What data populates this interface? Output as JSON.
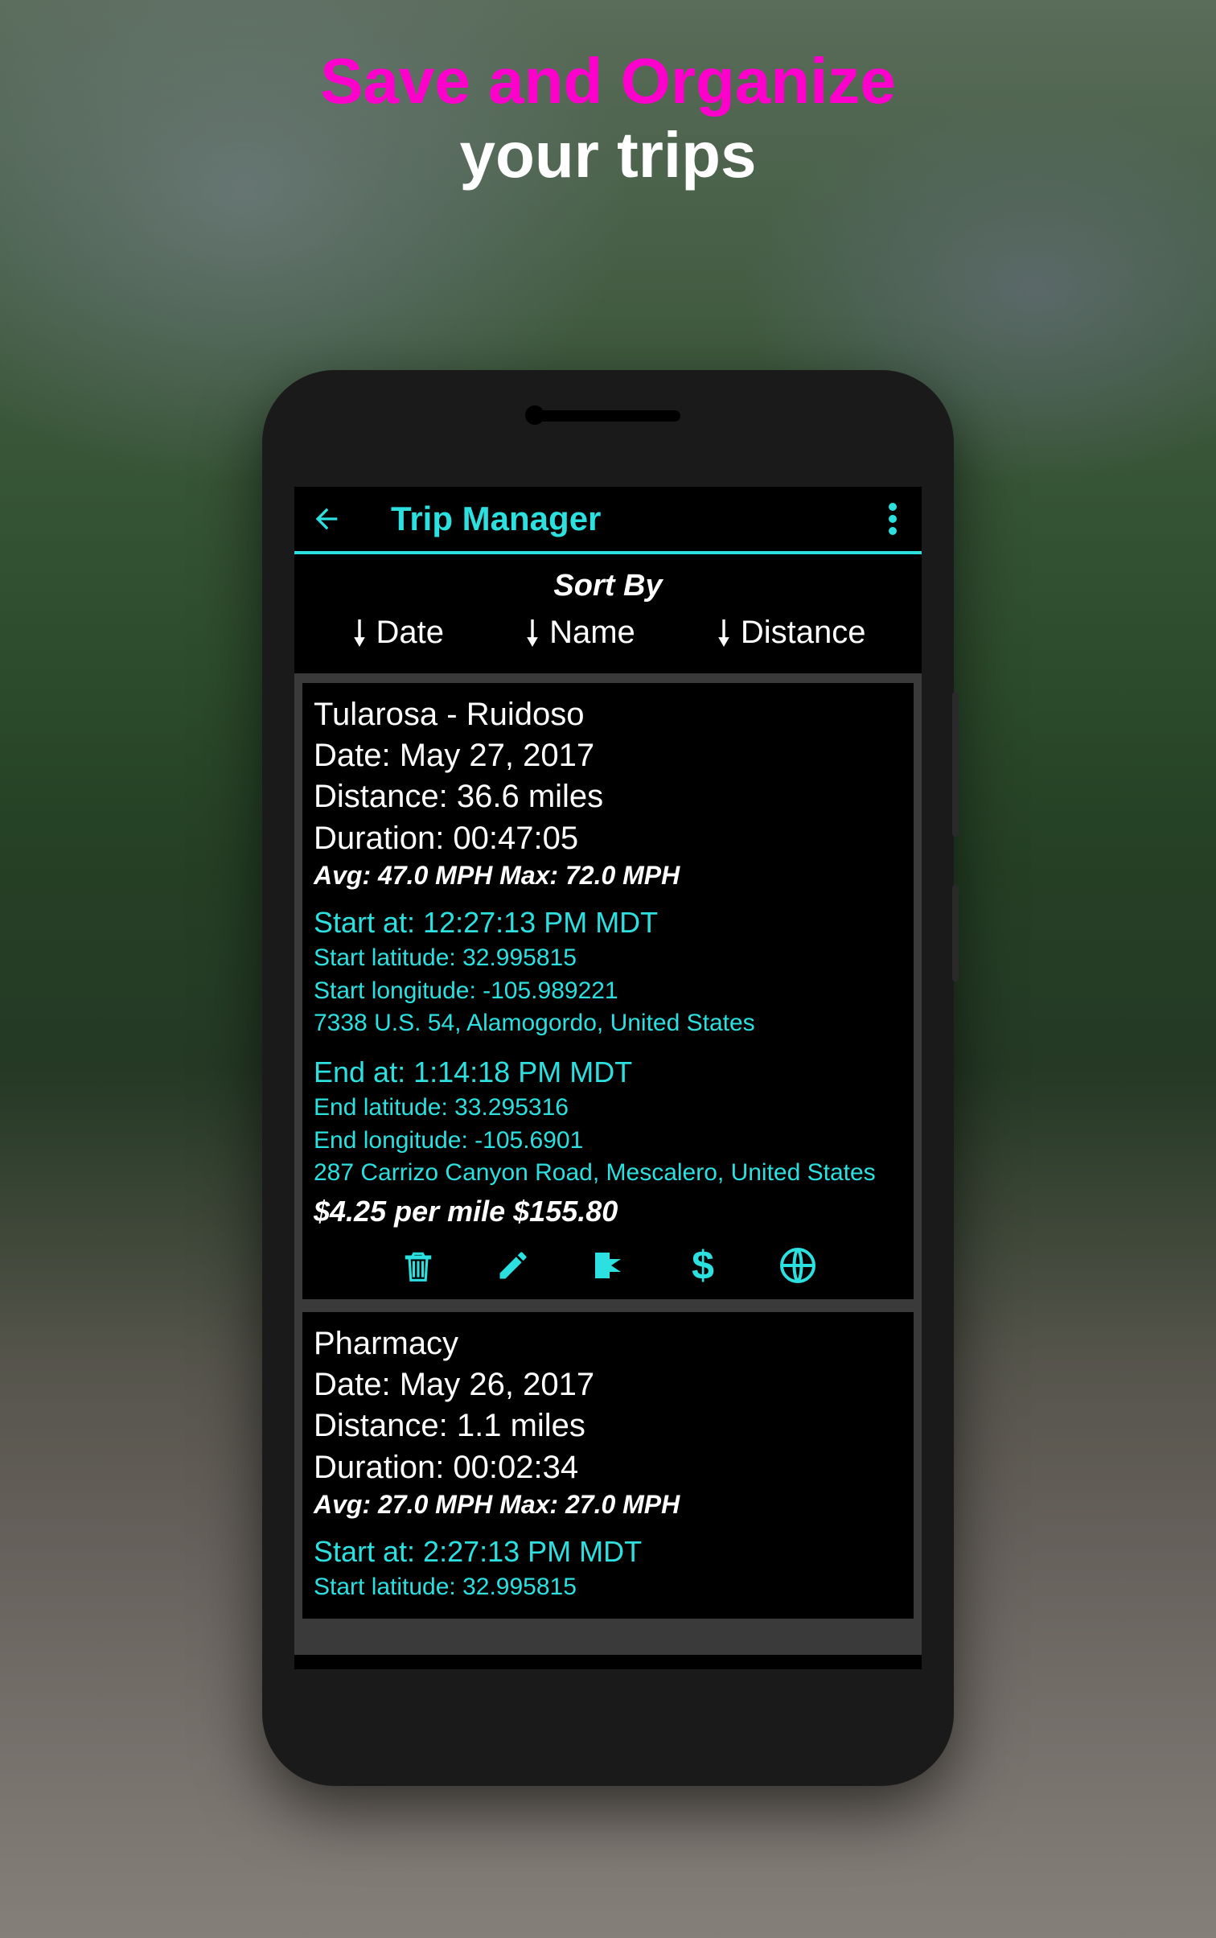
{
  "promo": {
    "line1": "Save and Organize",
    "line2": "your trips"
  },
  "appBar": {
    "title": "Trip Manager"
  },
  "sort": {
    "label": "Sort By",
    "options": {
      "date": "Date",
      "name": "Name",
      "distance": "Distance"
    }
  },
  "trips": [
    {
      "name": "Tularosa - Ruidoso",
      "date": "Date: May 27, 2017",
      "distance": "Distance: 36.6 miles",
      "duration": "Duration: 00:47:05",
      "avgmax": "Avg: 47.0 MPH   Max: 72.0 MPH",
      "startAt": "Start at: 12:27:13 PM MDT",
      "startLat": "Start latitude: 32.995815",
      "startLon": "Start longitude: -105.989221",
      "startAddr": "7338 U.S. 54, Alamogordo, United States",
      "endAt": "End at: 1:14:18 PM MDT",
      "endLat": "End latitude: 33.295316",
      "endLon": "End longitude: -105.6901",
      "endAddr": "287 Carrizo Canyon Road, Mescalero, United States",
      "cost": "$4.25 per mile   $155.80"
    },
    {
      "name": "Pharmacy",
      "date": "Date: May 26, 2017",
      "distance": "Distance: 1.1 miles",
      "duration": "Duration: 00:02:34",
      "avgmax": "Avg: 27.0 MPH   Max: 27.0 MPH",
      "startAt": "Start at:  2:27:13 PM MDT",
      "startLat": "Start latitude: 32.995815"
    }
  ]
}
